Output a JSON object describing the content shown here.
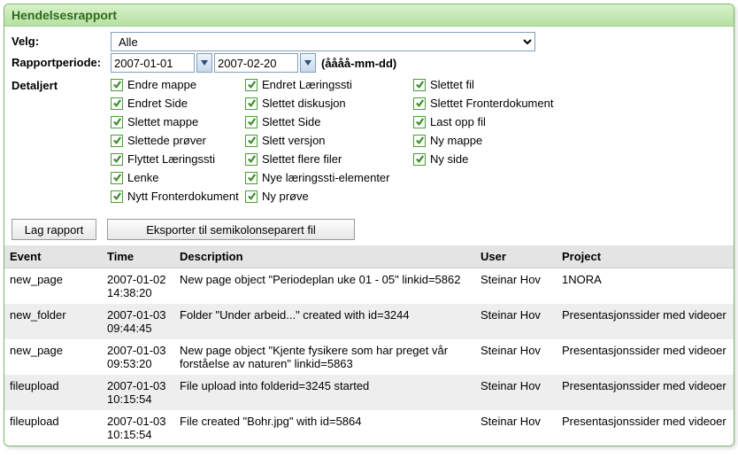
{
  "panel": {
    "title": "Hendelsesrapport"
  },
  "form": {
    "velg_label": "Velg:",
    "velg_value": "Alle",
    "rapportperiode_label": "Rapportperiode:",
    "date_from": "2007-01-01",
    "date_to": "2007-02-20",
    "date_hint": "(åååå-mm-dd)",
    "detaljert_label": "Detaljert"
  },
  "checkboxes": {
    "col1": [
      "Endre mappe",
      "Endret Side",
      "Slettet mappe",
      "Slettede prøver",
      "Flyttet Læringssti",
      "Lenke",
      "Nytt Fronterdokument"
    ],
    "col2": [
      "Endret Læringssti",
      "Slettet diskusjon",
      "Slettet Side",
      "Slett versjon",
      "Slettet flere filer",
      "Nye læringssti-elementer",
      "Ny prøve"
    ],
    "col3": [
      "Slettet fil",
      "Slettet Fronterdokument",
      "Last opp fil",
      "Ny mappe",
      "Ny side"
    ]
  },
  "buttons": {
    "lag_rapport": "Lag rapport",
    "eksporter": "Eksporter til semikolonseparert fil"
  },
  "table": {
    "headers": {
      "event": "Event",
      "time": "Time",
      "description": "Description",
      "user": "User",
      "project": "Project"
    },
    "rows": [
      {
        "event": "new_page",
        "time": "2007-01-02 14:38:20",
        "description": "New page object \"Periodeplan uke 01 - 05\" linkid=5862",
        "user": "Steinar Hov",
        "project": "1NORA"
      },
      {
        "event": "new_folder",
        "time": "2007-01-03 09:44:45",
        "description": "Folder \"Under arbeid...\" created with id=3244",
        "user": "Steinar Hov",
        "project": "Presentasjonssider med videoer"
      },
      {
        "event": "new_page",
        "time": "2007-01-03 09:53:20",
        "description": "New page object \"Kjente fysikere som har preget vår forståelse av naturen\" linkid=5863",
        "user": "Steinar Hov",
        "project": "Presentasjonssider med videoer"
      },
      {
        "event": "fileupload",
        "time": "2007-01-03 10:15:54",
        "description": "File upload into folderid=3245 started",
        "user": "Steinar Hov",
        "project": "Presentasjonssider med videoer"
      },
      {
        "event": "fileupload",
        "time": "2007-01-03 10:15:54",
        "description": "File created \"Bohr.jpg\" with id=5864",
        "user": "Steinar Hov",
        "project": "Presentasjonssider med videoer"
      }
    ]
  }
}
